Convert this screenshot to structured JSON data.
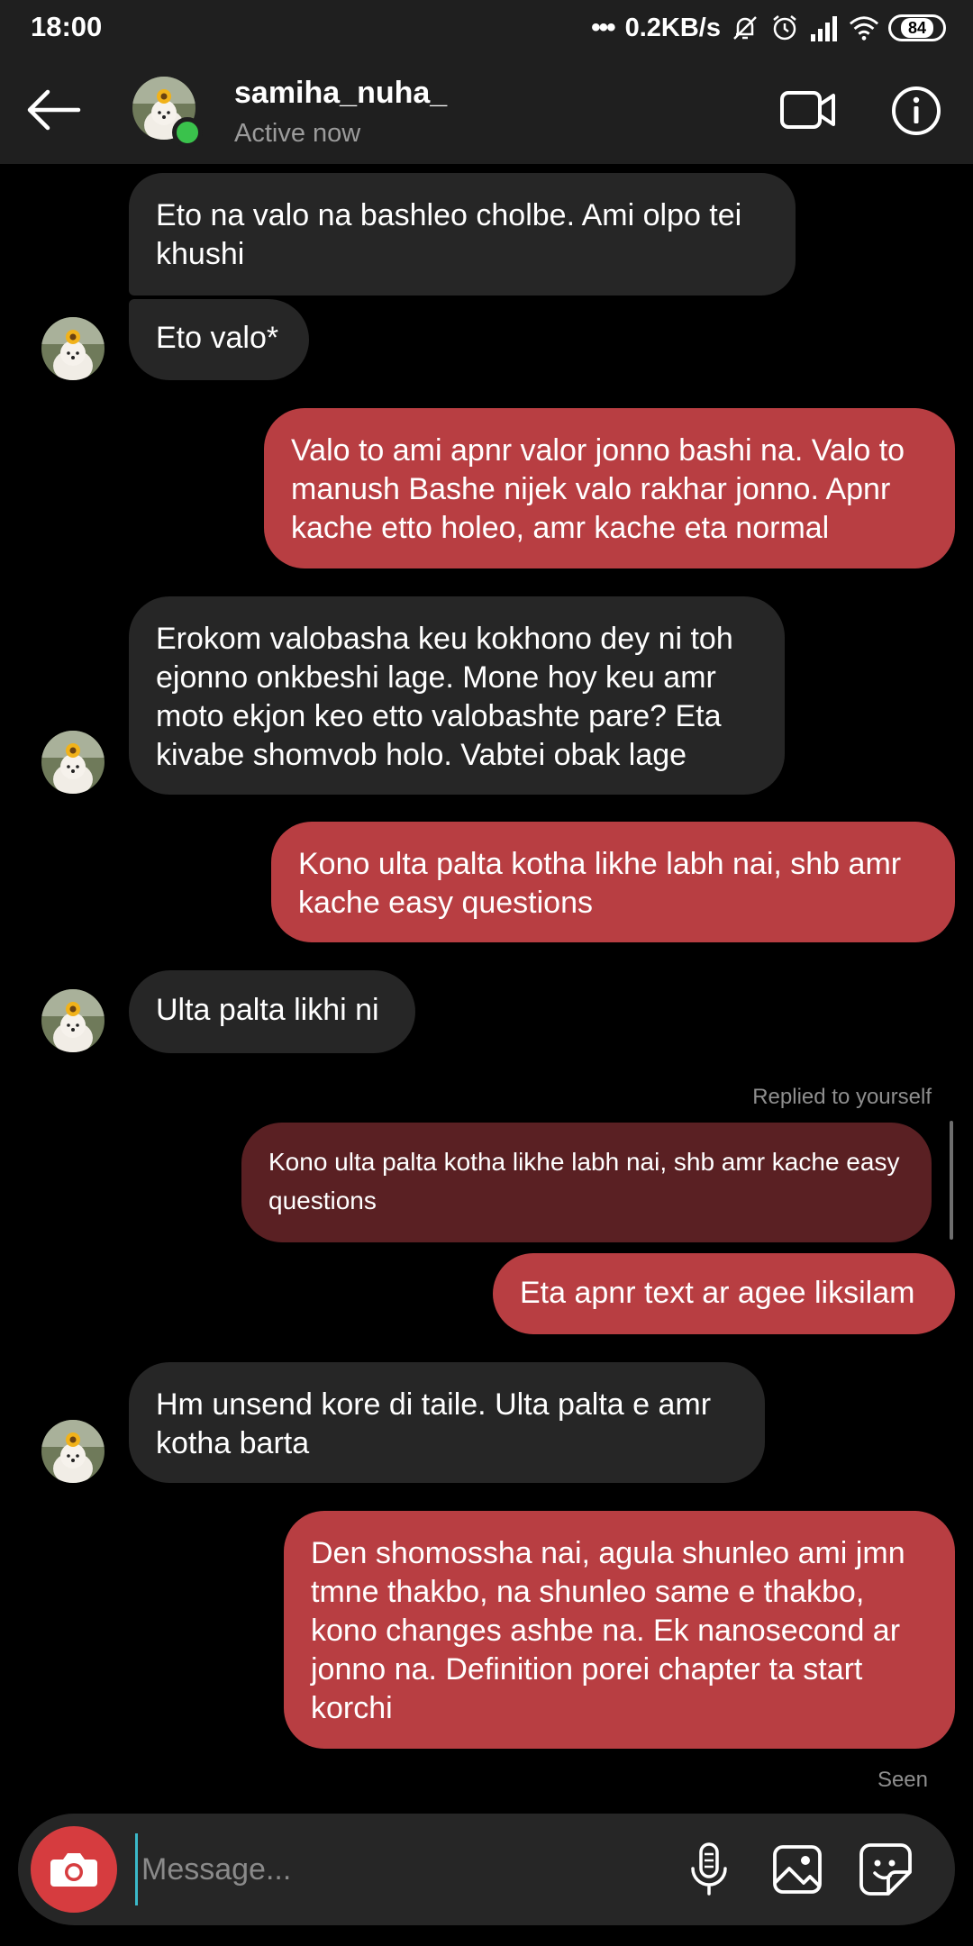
{
  "status_bar": {
    "time": "18:00",
    "dots": "•••",
    "speed": "0.2KB/s",
    "battery": "84"
  },
  "header": {
    "username": "samiha_nuha_",
    "status": "Active now"
  },
  "messages": [
    {
      "id": 1,
      "side": "in",
      "text": "Eto na valo na bashleo cholbe. Ami olpo tei khushi"
    },
    {
      "id": 2,
      "side": "in",
      "text": "Eto valo*"
    },
    {
      "id": 3,
      "side": "out",
      "text": "Valo to ami apnr valor jonno bashi na. Valo to manush Bashe nijek valo rakhar jonno. Apnr kache etto holeo, amr kache eta normal"
    },
    {
      "id": 4,
      "side": "in",
      "text": "Erokom valobasha keu kokhono dey ni toh ejonno onkbeshi lage. Mone hoy keu amr moto ekjon keo etto valobashte pare? Eta kivabe shomvob holo. Vabtei obak lage"
    },
    {
      "id": 5,
      "side": "out",
      "text": "Kono ulta palta kotha likhe labh nai, shb amr kache easy questions"
    },
    {
      "id": 6,
      "side": "in",
      "text": "Ulta palta likhi ni"
    },
    {
      "id": 7,
      "side": "out",
      "text": "Eta apnr text ar agee liksilam"
    },
    {
      "id": 8,
      "side": "in",
      "text": "Hm unsend kore di taile. Ulta palta e amr kotha barta"
    },
    {
      "id": 9,
      "side": "out",
      "text": "Den shomossha nai, agula shunleo ami jmn tmne thakbo, na shunleo same e thakbo, kono changes ashbe na. Ek nanosecond ar jonno na. Definition porei chapter ta start korchi"
    }
  ],
  "reply": {
    "label": "Replied to yourself",
    "quote": "Kono ulta palta kotha likhe labh nai, shb amr kache easy questions"
  },
  "seen_label": "Seen",
  "composer": {
    "placeholder": "Message..."
  },
  "colors": {
    "outgoing_bubble": "#b83e42",
    "incoming_bubble": "#262626",
    "reply_quote": "#5a2023",
    "camera_button": "#d63c3f",
    "online_dot": "#3ac24c"
  }
}
